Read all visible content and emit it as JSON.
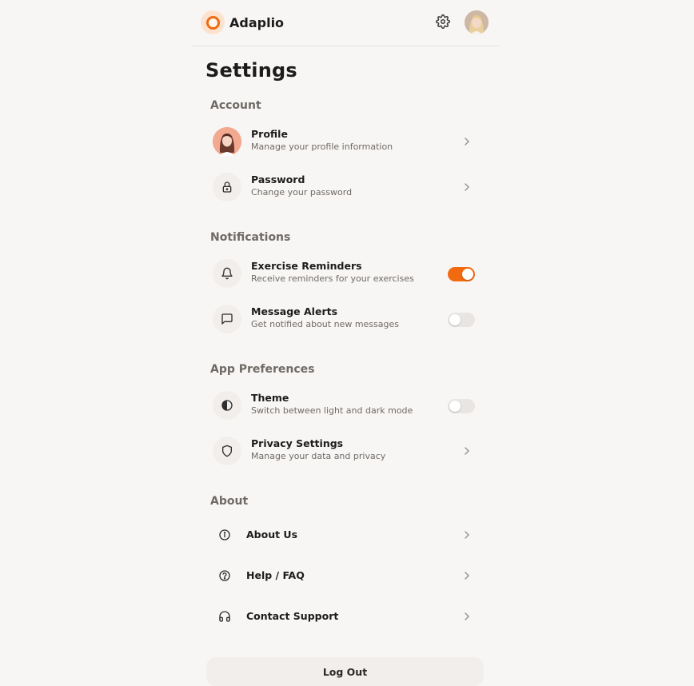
{
  "app": {
    "name": "Adaplio",
    "accent_color": "#f26a10"
  },
  "header": {
    "settings_icon": "gear-icon",
    "avatar": "user-avatar"
  },
  "page": {
    "title": "Settings"
  },
  "sections": {
    "account": {
      "title": "Account",
      "profile": {
        "title": "Profile",
        "subtitle": "Manage your profile information",
        "icon": "profile-avatar"
      },
      "password": {
        "title": "Password",
        "subtitle": "Change your password",
        "icon": "lock-icon"
      }
    },
    "notifications": {
      "title": "Notifications",
      "exercise_reminders": {
        "title": "Exercise Reminders",
        "subtitle": "Receive reminders for your exercises",
        "icon": "bell-icon",
        "enabled": true
      },
      "message_alerts": {
        "title": "Message Alerts",
        "subtitle": "Get notified about new messages",
        "icon": "message-icon",
        "enabled": false
      }
    },
    "app_preferences": {
      "title": "App Preferences",
      "theme": {
        "title": "Theme",
        "subtitle": "Switch between light and dark mode",
        "icon": "contrast-icon",
        "enabled": false
      },
      "privacy": {
        "title": "Privacy Settings",
        "subtitle": "Manage your data and privacy",
        "icon": "shield-icon"
      }
    },
    "about": {
      "title": "About",
      "about_us": {
        "title": "About Us",
        "icon": "info-icon"
      },
      "help": {
        "title": "Help / FAQ",
        "icon": "help-icon"
      },
      "contact": {
        "title": "Contact Support",
        "icon": "headphones-icon"
      }
    }
  },
  "logout": {
    "label": "Log Out"
  }
}
